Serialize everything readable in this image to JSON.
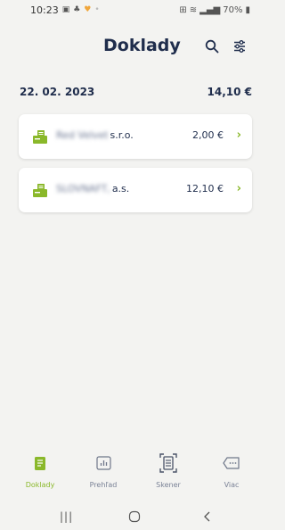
{
  "status_bar": {
    "time": "10:23",
    "battery": "70%"
  },
  "header": {
    "title": "Doklady"
  },
  "date_group": {
    "date": "22. 02. 2023",
    "total": "14,10 €"
  },
  "receipts": [
    {
      "merchant_blurred": "Red Velvet",
      "merchant_suffix": "s.r.o.",
      "amount": "2,00 €"
    },
    {
      "merchant_blurred": "SLOVNAFT,",
      "merchant_suffix": "a.s.",
      "amount": "12,10 €"
    }
  ],
  "bottom_nav": {
    "items": [
      {
        "label": "Doklady",
        "icon": "receipt-icon",
        "active": true
      },
      {
        "label": "Prehľad",
        "icon": "chart-icon",
        "active": false
      },
      {
        "label": "Skener",
        "icon": "scanner-icon",
        "active": false
      },
      {
        "label": "Viac",
        "icon": "more-icon",
        "active": false
      }
    ]
  },
  "colors": {
    "accent": "#8ab82a",
    "text_primary": "#1f2d4c",
    "background": "#f3f3f1",
    "card": "#ffffff"
  }
}
